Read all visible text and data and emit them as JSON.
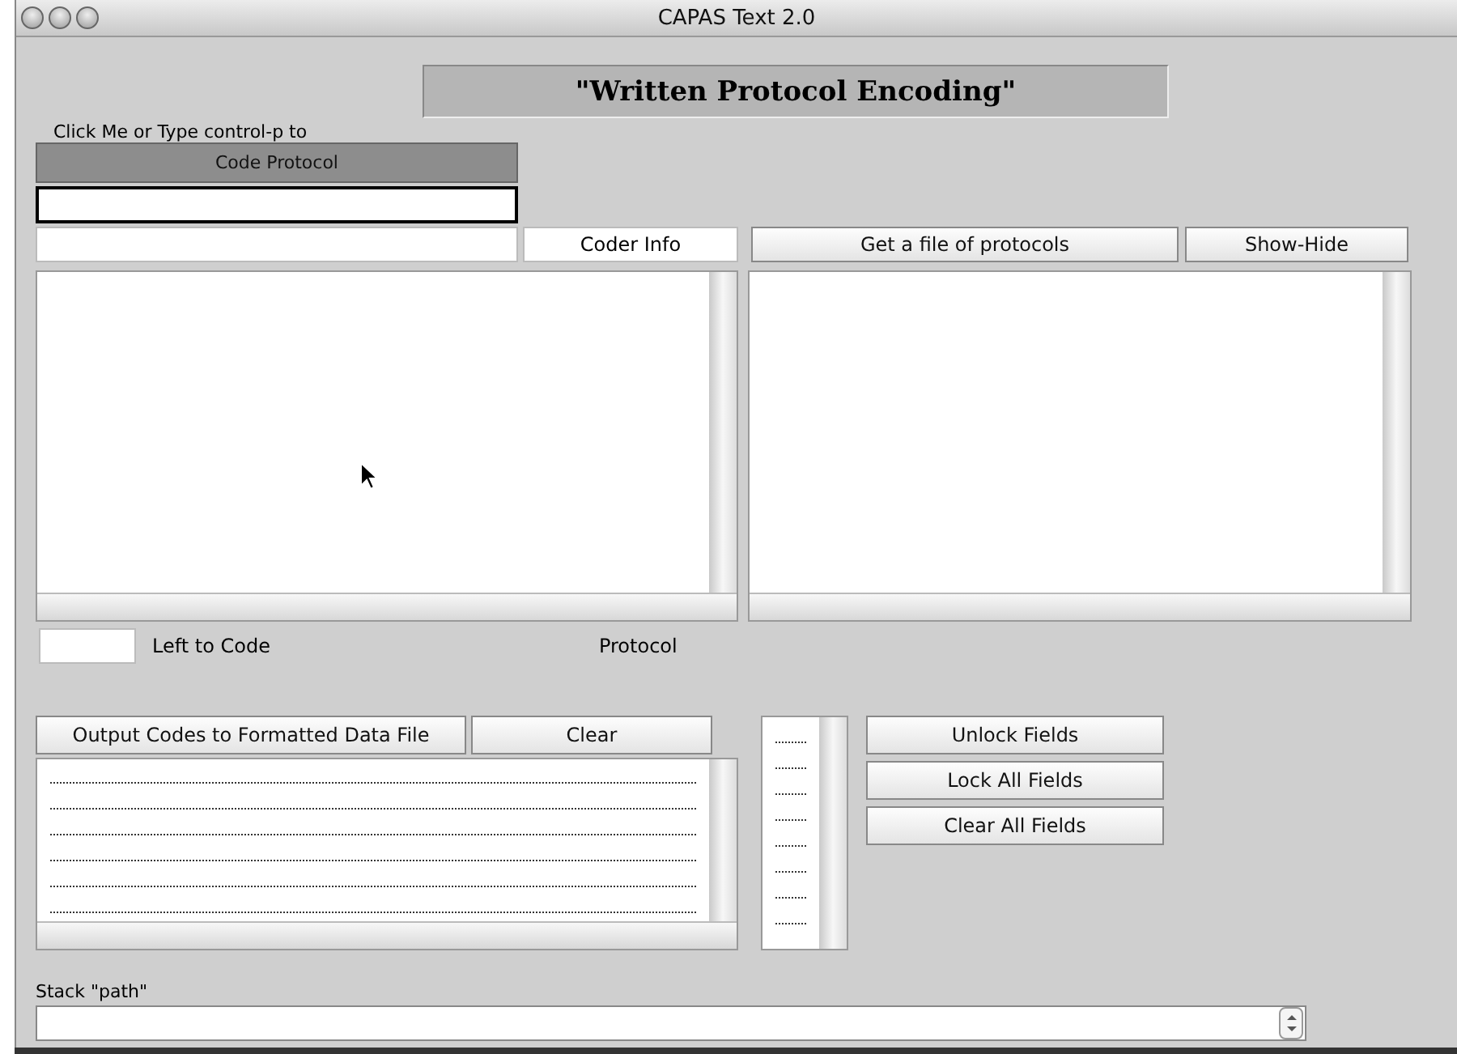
{
  "window": {
    "title": "CAPAS Text 2.0"
  },
  "heading": "\"Written Protocol Encoding\"",
  "code_section": {
    "hint": "Click Me or Type control-p to",
    "button": "Code Protocol"
  },
  "coder_row": {
    "coder_info": "Coder Info",
    "get_file_button": "Get a file of protocols",
    "show_hide_button": "Show-Hide"
  },
  "status_row": {
    "left_to_code_label": "Left to Code",
    "protocol_label": "Protocol"
  },
  "output_row": {
    "output_button": "Output Codes to Formatted Data File",
    "clear_button": "Clear"
  },
  "field_buttons": [
    "Unlock Fields",
    "Lock All Fields",
    "Clear All Fields"
  ],
  "stack": {
    "label": "Stack \"path\""
  }
}
